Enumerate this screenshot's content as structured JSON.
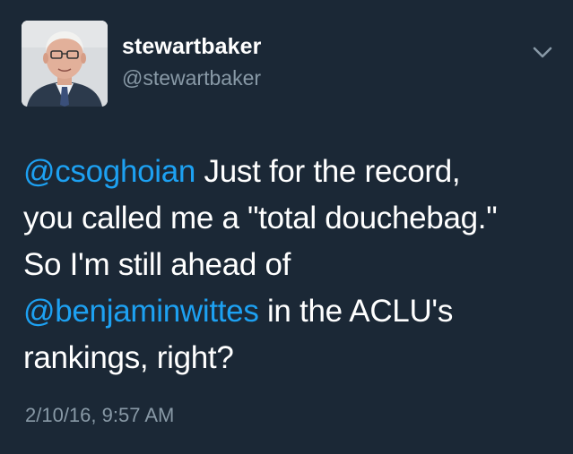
{
  "profile": {
    "display_name": "stewartbaker",
    "handle": "@stewartbaker",
    "avatar_icon": "profile-photo"
  },
  "menu": {
    "icon": "chevron-down-icon"
  },
  "tweet": {
    "lines": [
      {
        "mention": "@csoghoian",
        "text": " Just for the record,"
      },
      {
        "text": "you called me a \"total douchebag.\""
      },
      {
        "text": "So I'm still ahead of"
      },
      {
        "mention": "@benjaminwittes",
        "text": " in the ACLU's"
      },
      {
        "text": "rankings, right?"
      }
    ],
    "timestamp": "2/10/16, 9:57 AM"
  },
  "colors": {
    "background": "#1b2836",
    "text": "#ffffff",
    "secondary": "#8899a6",
    "link": "#1da1f2"
  }
}
